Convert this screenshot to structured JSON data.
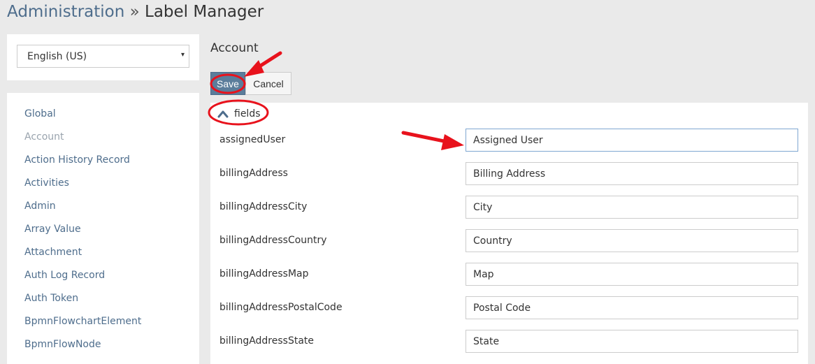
{
  "header": {
    "breadcrumb_root": "Administration",
    "separator": "»",
    "title": "Label Manager"
  },
  "language": {
    "selected": "English (US)",
    "caret": "▾"
  },
  "scopes": [
    {
      "label": "Global",
      "active": false
    },
    {
      "label": "Account",
      "active": true
    },
    {
      "label": "Action History Record",
      "active": false
    },
    {
      "label": "Activities",
      "active": false
    },
    {
      "label": "Admin",
      "active": false
    },
    {
      "label": "Array Value",
      "active": false
    },
    {
      "label": "Attachment",
      "active": false
    },
    {
      "label": "Auth Log Record",
      "active": false
    },
    {
      "label": "Auth Token",
      "active": false
    },
    {
      "label": "BpmnFlowchartElement",
      "active": false
    },
    {
      "label": "BpmnFlowNode",
      "active": false
    }
  ],
  "content": {
    "scope_title": "Account",
    "save_label": "Save",
    "cancel_label": "Cancel",
    "section_label": "fields"
  },
  "fields": [
    {
      "name": "assignedUser",
      "value": "Assigned User"
    },
    {
      "name": "billingAddress",
      "value": "Billing Address"
    },
    {
      "name": "billingAddressCity",
      "value": "City"
    },
    {
      "name": "billingAddressCountry",
      "value": "Country"
    },
    {
      "name": "billingAddressMap",
      "value": "Map"
    },
    {
      "name": "billingAddressPostalCode",
      "value": "Postal Code"
    },
    {
      "name": "billingAddressState",
      "value": "State"
    }
  ],
  "colors": {
    "link": "#4e6d8c",
    "primary_button": "#5b7d9b",
    "annotation": "#e8121c",
    "background": "#eaeaea"
  }
}
